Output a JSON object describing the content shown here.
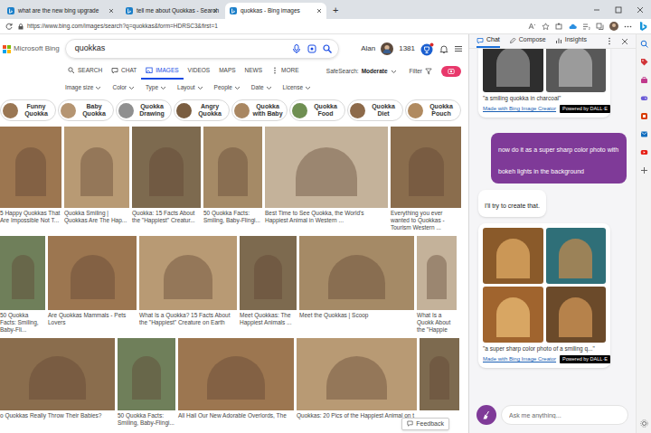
{
  "browser": {
    "tabs": [
      {
        "label": "what are the new bing upgrade",
        "selected": false
      },
      {
        "label": "tell me about Quokkas - Search",
        "selected": false
      },
      {
        "label": "quokkas - Bing images",
        "selected": true
      }
    ],
    "new_tab": "+",
    "address": "https://www.bing.com/images/search?q=quokkas&form=HDRSC3&first=1"
  },
  "page": {
    "logo": "Microsoft Bing",
    "search": {
      "value": "quokkas"
    },
    "user": "Alan",
    "points": "1381",
    "nav": [
      {
        "label": "SEARCH",
        "selected": false
      },
      {
        "label": "CHAT",
        "selected": false
      },
      {
        "label": "IMAGES",
        "selected": true
      },
      {
        "label": "VIDEOS",
        "selected": false
      },
      {
        "label": "MAPS",
        "selected": false
      },
      {
        "label": "NEWS",
        "selected": false
      },
      {
        "label": "MORE",
        "selected": false
      }
    ],
    "safesearch": {
      "label": "SafeSearch:",
      "value": "Moderate"
    },
    "filter": "Filter",
    "filters": [
      "Image size",
      "Color",
      "Type",
      "Layout",
      "People",
      "Date",
      "License"
    ],
    "chips": [
      "Funny Quokka",
      "Baby Quokka",
      "Quokka Drawing",
      "Angry Quokka",
      "Quokka with Baby",
      "Quokka Food",
      "Quokka Diet",
      "Quokka Pouch"
    ],
    "image_rows": [
      [
        {
          "caption": "5 Happy Quokkas That Are Impossible Not T..."
        },
        {
          "caption": "Quokka Smiling | Quokkas Are The Hap..."
        },
        {
          "caption": "Quokka: 15 Facts About the \"Happiest\" Creatur..."
        },
        {
          "caption": "50 Quokka Facts: Smiling, Baby-Flingi..."
        },
        {
          "caption": "Best Time to See Quokka, the World's Happiest Animal in Western ..."
        },
        {
          "caption": "Everything you ever wanted to Quokkas - Tourism Western ..."
        }
      ],
      [
        {
          "caption": "50 Quokka Facts: Smiling, Baby-Fli..."
        },
        {
          "caption": "Are Quokkas Mammals - Pets Lovers"
        },
        {
          "caption": "What Is a Quokka? 15 Facts About the \"Happiest\" Creature on Earth"
        },
        {
          "caption": "Meet Quokkas: The Happiest Animals ..."
        },
        {
          "caption": "Meet the Quokkas | Scoop"
        },
        {
          "caption": "What Is a Quokk About the \"Happie"
        }
      ],
      [
        {
          "caption": "o Quokkas Really Throw Their Babies?"
        },
        {
          "caption": "50 Quokka Facts: Smiling, Baby-Flingi..."
        },
        {
          "caption": "All Hail Our New Adorable Overlords, The"
        },
        {
          "caption": "Quokkas: 20 Pics of the Happiest Animal on t"
        },
        {}
      ]
    ],
    "feedback": "Feedback"
  },
  "sidebar": {
    "tabs": [
      {
        "label": "Chat",
        "selected": true
      },
      {
        "label": "Compose",
        "selected": false
      },
      {
        "label": "Insights",
        "selected": false
      }
    ],
    "messages": [
      {
        "kind": "images",
        "caption": "\"a smiling quokka in charcoal\"",
        "credit": "Made with Bing Image Creator",
        "badge": "Powered by DALL·E"
      },
      {
        "kind": "user",
        "text": "now do it as a super sharp color photo with bokeh lights in the background"
      },
      {
        "kind": "bot",
        "text": "I'll try to create that."
      },
      {
        "kind": "images",
        "caption": "\"a super sharp color photo of a smiling q...\"",
        "credit": "Made with Bing Image Creator",
        "badge": "Powered by DALL·E"
      }
    ],
    "input": {
      "placeholder": "Ask me anything..."
    }
  }
}
